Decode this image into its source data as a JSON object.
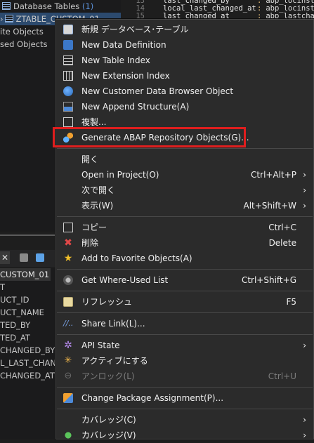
{
  "tree": {
    "items": [
      {
        "label": "Database Tables",
        "count": "(1)"
      },
      {
        "label": "ZTABLE_CUSTOM_01"
      },
      {
        "label": "ite Objects"
      },
      {
        "label": "sed Objects"
      }
    ]
  },
  "editor": {
    "lines": [
      {
        "num": "13",
        "name": "last_changed_by",
        "colon": ":",
        "type": "abp_locinst"
      },
      {
        "num": "14",
        "name": "local_last_changed_at",
        "colon": ":",
        "type": "abp_locinst"
      },
      {
        "num": "15",
        "name": "last_changed_at",
        "colon": ":",
        "type": "abp_lastchan"
      }
    ]
  },
  "outline": {
    "close_glyph": "✕",
    "items": [
      "CUSTOM_01",
      "T",
      "UCT_ID",
      "UCT_NAME",
      "TED_BY",
      "TED_AT",
      "CHANGED_BY",
      "L_LAST_CHANG",
      "CHANGED_AT"
    ]
  },
  "menu": {
    "items": [
      {
        "label": "新規 データベース･テーブル",
        "icon": "database-table-icon"
      },
      {
        "label": "New Data Definition",
        "icon": "data-definition-icon"
      },
      {
        "label": "New Table Index",
        "icon": "table-index-icon"
      },
      {
        "label": "New Extension Index",
        "icon": "extension-index-icon"
      },
      {
        "label": "New Customer Data Browser Object",
        "icon": "globe-icon"
      },
      {
        "label": "New Append Structure(A)",
        "icon": "append-structure-icon"
      },
      {
        "label": "複製...",
        "icon": "copy-document-icon"
      },
      {
        "label": "Generate ABAP Repository Objects(G)...",
        "icon": "generate-objects-icon"
      },
      {
        "label": "開く"
      },
      {
        "label": "Open in Project(O)",
        "shortcut": "Ctrl+Alt+P",
        "arrow": "›"
      },
      {
        "label": "次で開く",
        "arrow": "›"
      },
      {
        "label": "表示(W)",
        "shortcut": "Alt+Shift+W",
        "arrow": "›"
      },
      {
        "label": "コピー",
        "shortcut": "Ctrl+C",
        "icon": "copy-icon"
      },
      {
        "label": "削除",
        "shortcut": "Delete",
        "icon": "delete-icon",
        "glyph": "✖"
      },
      {
        "label": "Add to Favorite Objects(A)",
        "icon": "star-icon",
        "glyph": "★"
      },
      {
        "label": "Get Where-Used List",
        "shortcut": "Ctrl+Shift+G",
        "icon": "where-used-icon"
      },
      {
        "label": "リフレッシュ",
        "shortcut": "F5",
        "icon": "refresh-icon"
      },
      {
        "label": "Share Link(L)...",
        "icon": "share-link-icon",
        "glyph": "//.."
      },
      {
        "label": "API State",
        "arrow": "›",
        "icon": "api-state-gear-icon",
        "glyph": "✲"
      },
      {
        "label": "アクティブにする",
        "icon": "activate-icon",
        "glyph": "✳"
      },
      {
        "label": "アンロック(L)",
        "shortcut": "Ctrl+U",
        "icon": "unlock-icon",
        "glyph": "⊖"
      },
      {
        "label": "Change Package Assignment(P)...",
        "icon": "package-assignment-icon"
      },
      {
        "label": "カバレッジ(C)",
        "arrow": "›"
      },
      {
        "label": "カバレッジ(V)",
        "arrow": "›",
        "icon": "coverage-icon"
      }
    ]
  },
  "colors": {
    "menu_bg": "#2b2b2b",
    "highlight_border": "#e01e1e",
    "disabled_text": "#7c7c7c"
  }
}
